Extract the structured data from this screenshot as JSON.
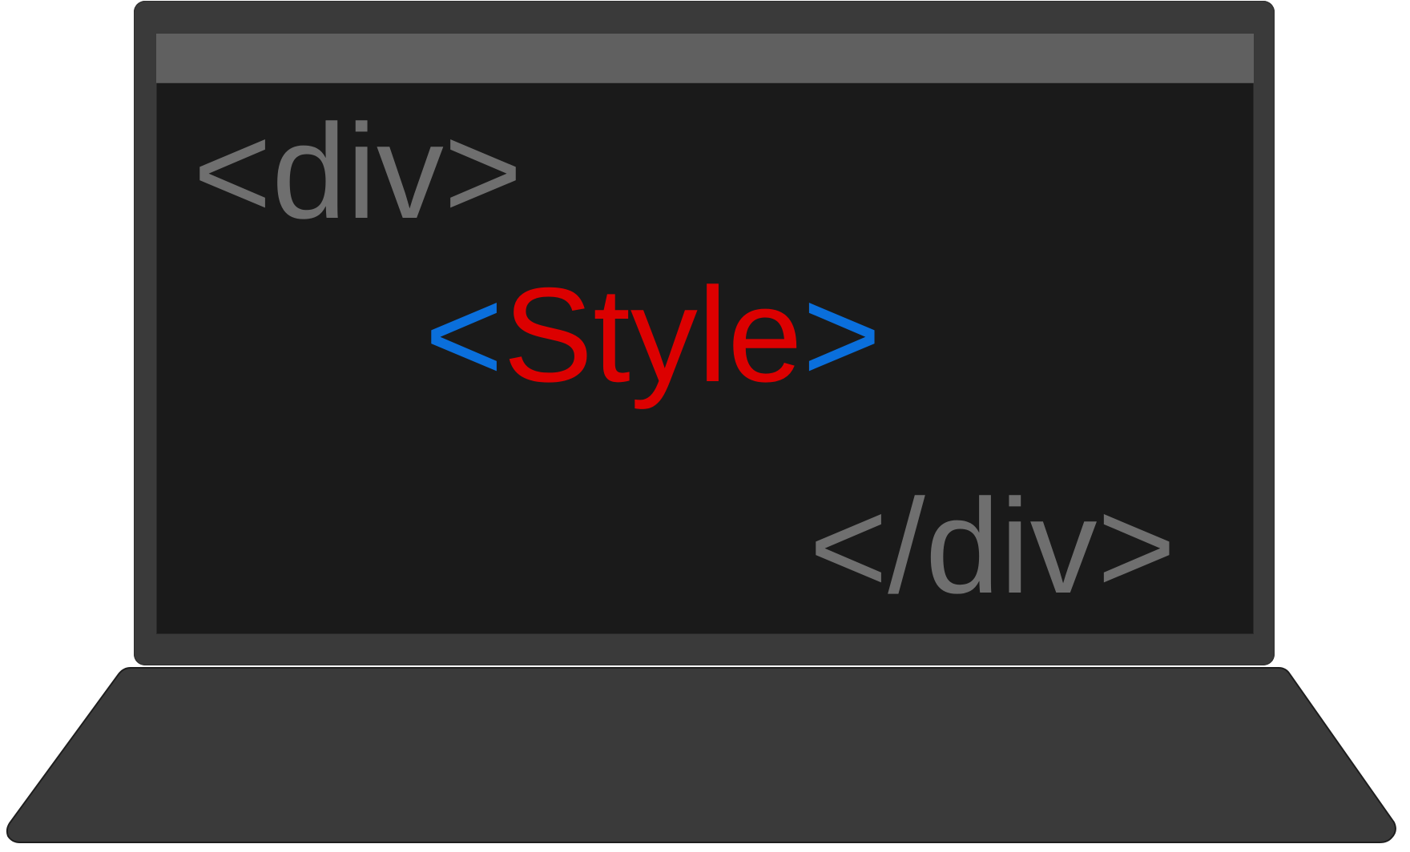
{
  "colors": {
    "lid": "#3a3a3a",
    "screen_bg": "#1a1a1a",
    "title_bar": "#606060",
    "base": "#3a3a3a",
    "tag_gray": "#6f6f6f",
    "bracket_blue": "#0a6fdc",
    "style_red": "#dc0000"
  },
  "code": {
    "open_tag": "<div>",
    "style_open_bracket": "<",
    "style_word": "Style",
    "style_close_bracket": ">",
    "close_tag": "</div>"
  }
}
